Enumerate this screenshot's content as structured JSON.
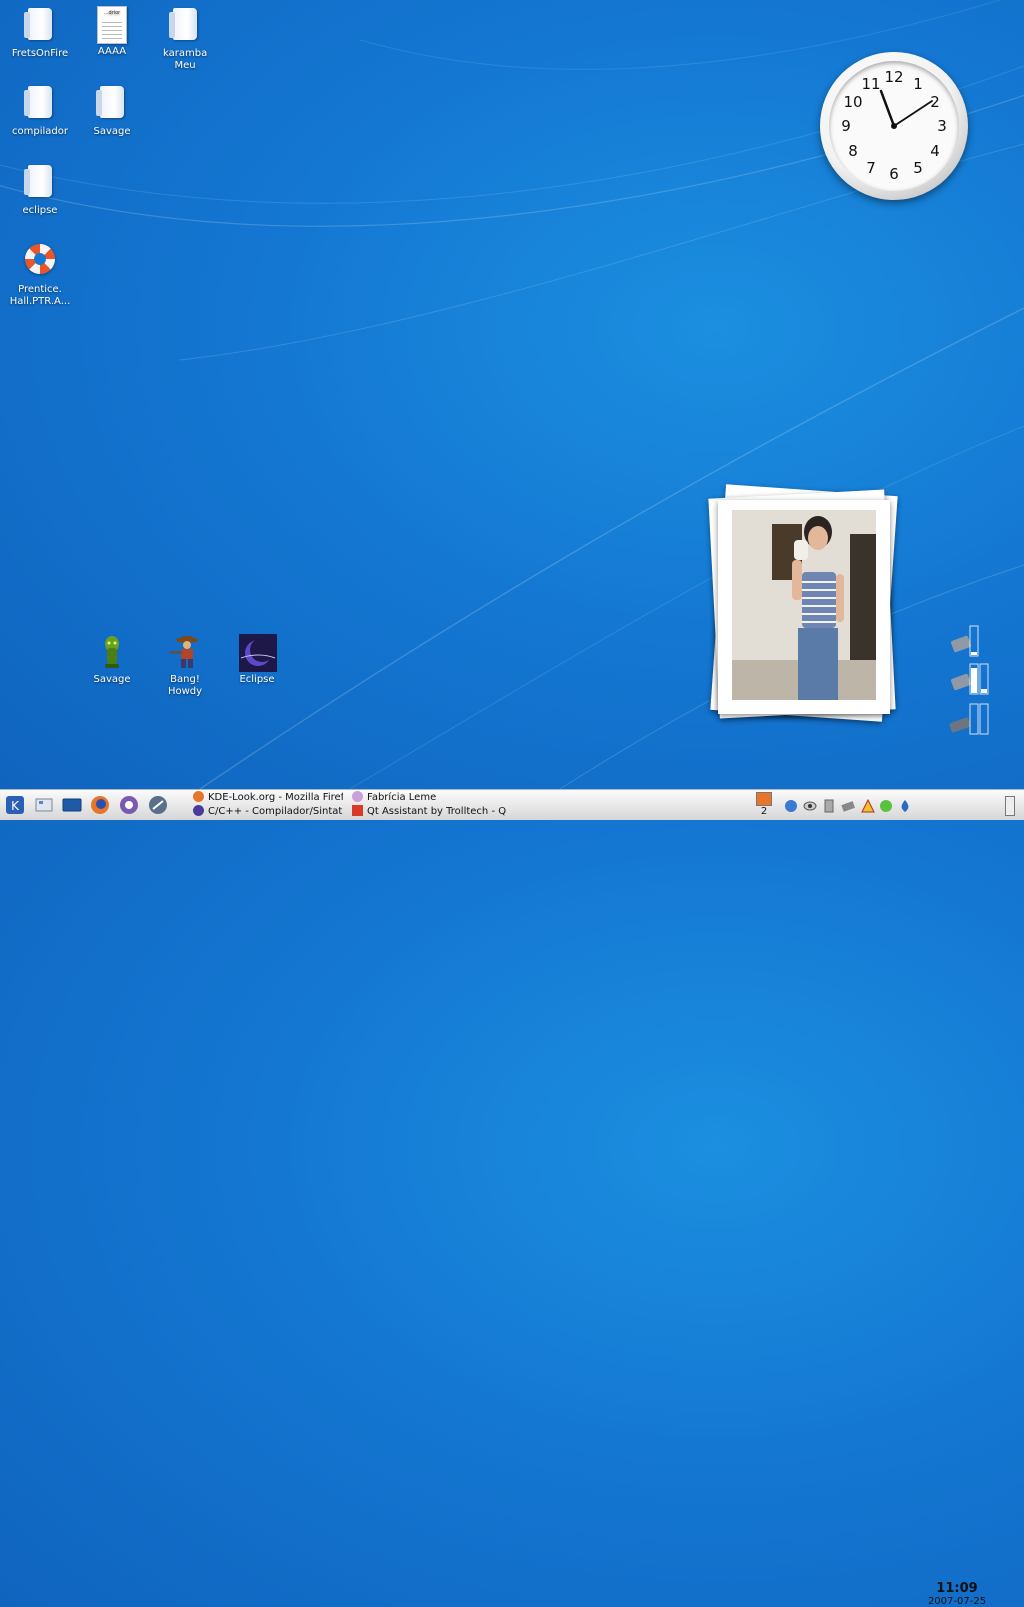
{
  "desktop": {
    "icons": [
      {
        "label": "FretsOnFire",
        "icon": "folder-icon"
      },
      {
        "label": "AAAA",
        "icon": "document-icon",
        "doc_header": "...drior"
      },
      {
        "label": "karamba Meu",
        "icon": "folder-icon"
      },
      {
        "label": "compilador",
        "icon": "folder-icon"
      },
      {
        "label": "Savage",
        "icon": "folder-icon"
      },
      {
        "label": "eclipse",
        "icon": "folder-icon"
      },
      {
        "label": "Prentice. Hall.PTR.A...",
        "icon": "lifebuoy-icon"
      }
    ],
    "app_icons": [
      {
        "label": "Savage",
        "icon": "savage-game-icon"
      },
      {
        "label": "Bang! Howdy",
        "icon": "cowboy-game-icon"
      },
      {
        "label": "Eclipse",
        "icon": "eclipse-ide-icon"
      }
    ]
  },
  "clock_widget": {
    "numbers": [
      "12",
      "1",
      "2",
      "3",
      "4",
      "5",
      "6",
      "7",
      "8",
      "9",
      "10",
      "11"
    ],
    "time": "11:09"
  },
  "taskbar": {
    "launchers": [
      "kde-menu-icon",
      "desktop-icon",
      "konsole-icon",
      "firefox-icon",
      "kde-help-icon",
      "konqueror-icon"
    ],
    "tasks": [
      {
        "label": "KDE-Look.org - Mozilla Firefo",
        "icon": "firefox-icon"
      },
      {
        "label": "Fabrícia Leme",
        "icon": "kopete-icon"
      },
      {
        "label": "C/C++ - Compilador/Sintatic",
        "icon": "eclipse-icon"
      },
      {
        "label": "Qt Assistant by Trolltech - Q",
        "icon": "qt-assistant-icon"
      }
    ],
    "pager_number": "2",
    "tray": [
      "kopete-tray-icon",
      "eye-icon",
      "usb-icon",
      "network-icon",
      "warning-icon",
      "green-status-icon",
      "drop-icon"
    ],
    "clock_time": "11:09",
    "clock_date": "2007-07-25"
  },
  "colors": {
    "desktop_bg": "#1477d2",
    "taskbar_bg": "#e9e9e9",
    "clock_face": "#fafafa"
  }
}
